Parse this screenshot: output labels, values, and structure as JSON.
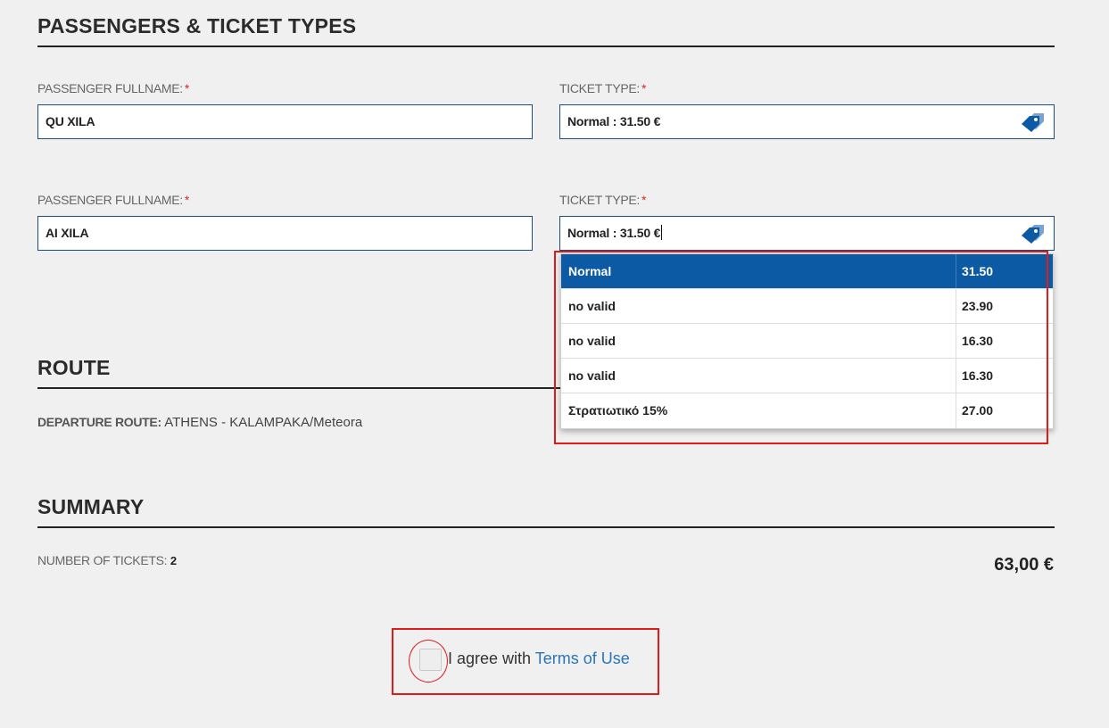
{
  "passengers_section": {
    "title": "PASSENGERS & TICKET TYPES",
    "required_mark": "*",
    "rows": [
      {
        "fullname_label": "PASSENGER FULLNAME:",
        "fullname_value": "QU XILA",
        "ticket_label": "TICKET TYPE:",
        "ticket_value": "Normal : 31.50 €"
      },
      {
        "fullname_label": "PASSENGER FULLNAME:",
        "fullname_value": "AI XILA",
        "ticket_label": "TICKET TYPE:",
        "ticket_value": "Normal : 31.50 €"
      }
    ],
    "ticket_icon": "price-tag-icon"
  },
  "ticket_dropdown": {
    "options": [
      {
        "name": "Normal",
        "price": "31.50",
        "selected": true
      },
      {
        "name": "no valid",
        "price": "23.90",
        "selected": false
      },
      {
        "name": "no valid",
        "price": "16.30",
        "selected": false
      },
      {
        "name": "no valid",
        "price": "16.30",
        "selected": false
      },
      {
        "name": "Στρατιωτικό 15%",
        "price": "27.00",
        "selected": false
      }
    ]
  },
  "route_section": {
    "title": "ROUTE",
    "departure_label": "DEPARTURE ROUTE:",
    "departure_value": "ATHENS - KALAMPAKA/Meteora"
  },
  "summary_section": {
    "title": "SUMMARY",
    "tickets_label": "NUMBER OF TICKETS:",
    "tickets_count": "2",
    "total": "63,00 €"
  },
  "terms": {
    "text": "I agree with",
    "link_text": "Terms of Use",
    "checked": false
  },
  "colors": {
    "accent": "#0c5aa4",
    "input_border": "#1c4d7d",
    "annotation": "#e01b1b",
    "link": "#2a74b8",
    "background": "#f0f0f0"
  }
}
